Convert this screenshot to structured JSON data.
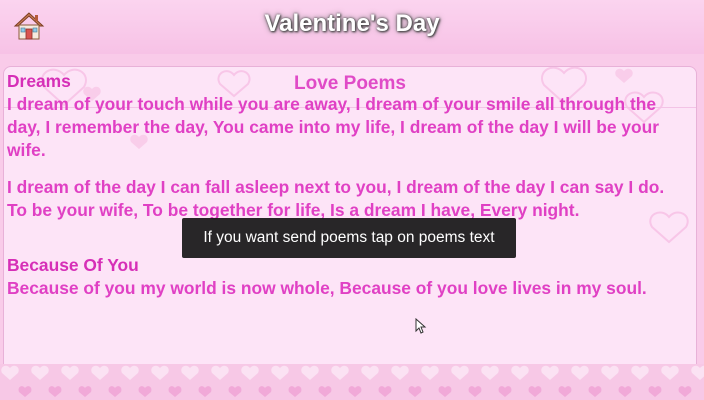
{
  "header": {
    "title": "Valentine's Day",
    "home_icon": "house-icon"
  },
  "card": {
    "title": "Love Poems"
  },
  "poems": [
    {
      "heading": "Dreams",
      "paragraphs": [
        "I dream of your touch while you are away, I dream of your smile all through the day, I remember the day, You came into my life, I dream of the day I will be your wife.",
        "I dream of the day I can fall asleep next to you, I dream of the day I can say I do. To be your wife, To be together for life, Is a dream I have, Every night."
      ]
    },
    {
      "heading": "Because Of You",
      "paragraphs": [
        "Because of you my world is now whole, Because of you love lives in my soul."
      ]
    }
  ],
  "toast": {
    "message": "If you want send poems tap on poems text"
  },
  "colors": {
    "background": "#f9cbe9",
    "card": "#fde4f7",
    "poem_text": "#e040c4",
    "title_pink": "#e04bc7",
    "toast_bg": "#161616"
  },
  "icons": [
    "house-icon",
    "heart-icon",
    "mouse-pointer-icon"
  ]
}
